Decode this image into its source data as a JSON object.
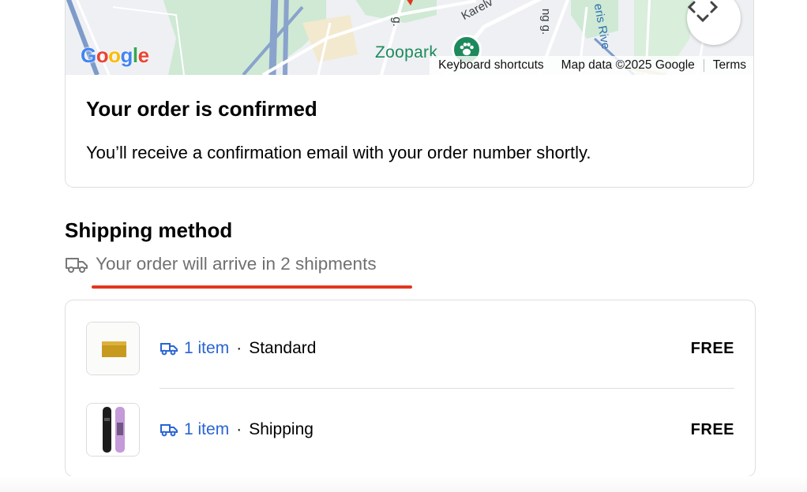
{
  "map": {
    "poi_name": "Zoopark",
    "street_labels": [
      "Karelv",
      "g.",
      "ng g.",
      "eris Rive"
    ],
    "logo_text": "Google",
    "attribution": [
      "Keyboard shortcuts",
      "Map data ©2025 Google",
      "Terms"
    ]
  },
  "confirmation": {
    "title": "Your order is confirmed",
    "message": "You’ll receive a confirmation email with your order number shortly."
  },
  "shipping": {
    "title": "Shipping method",
    "summary": "Your order will arrive in 2 shipments",
    "shipments": [
      {
        "count": "1 item",
        "separator": "·",
        "method": "Standard",
        "price": "FREE",
        "thumbnail": "gold-bar-product"
      },
      {
        "count": "1 item",
        "separator": "·",
        "method": "Shipping",
        "price": "FREE",
        "thumbnail": "snowboard-product"
      }
    ]
  },
  "colors": {
    "link_blue": "#2a64d4",
    "annotation_red": "#e3361f",
    "poi_green": "#1e8a5c"
  }
}
